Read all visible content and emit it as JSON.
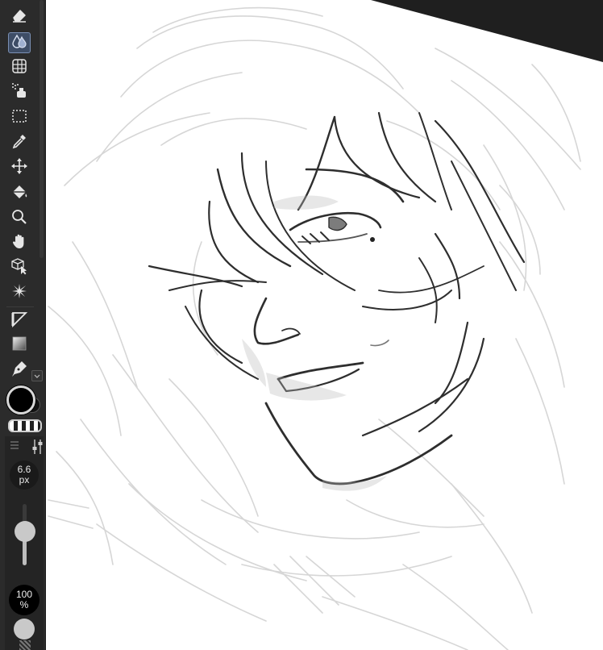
{
  "toolbar": {
    "tools": [
      {
        "name": "eraser-tool",
        "icon": "eraser-icon"
      },
      {
        "name": "blend-tool",
        "icon": "blend-drops-icon",
        "active": true
      },
      {
        "name": "figure-tool",
        "icon": "grid-shape-icon"
      },
      {
        "name": "airbrush-tool",
        "icon": "airbrush-icon"
      },
      {
        "name": "selection-tool",
        "icon": "marquee-icon"
      },
      {
        "name": "eyedropper-tool",
        "icon": "eyedropper-icon"
      },
      {
        "name": "move-tool",
        "icon": "move-arrows-icon"
      },
      {
        "name": "fill-tool",
        "icon": "paint-bucket-icon"
      },
      {
        "name": "zoom-tool",
        "icon": "magnifier-icon"
      },
      {
        "name": "hand-tool",
        "icon": "hand-icon"
      },
      {
        "name": "object-tool",
        "icon": "cube-cursor-icon"
      },
      {
        "name": "auto-select-tool",
        "icon": "magic-wand-icon"
      },
      {
        "name": "ruler-tool",
        "icon": "ruler-triangle-icon"
      },
      {
        "name": "gradient-tool",
        "icon": "gradient-icon"
      },
      {
        "name": "pen-tool",
        "icon": "pen-nib-icon"
      }
    ],
    "main_color": "#000000",
    "sub_color": "#111111",
    "accent": "#7a8fb3"
  },
  "brush": {
    "size_value": "6.6",
    "size_unit": "px",
    "opacity_value": "100",
    "opacity_unit": "%",
    "size_level": 0.55
  },
  "canvas": {
    "paper_color": "#ffffff",
    "background_color": "#1f1f1f"
  }
}
